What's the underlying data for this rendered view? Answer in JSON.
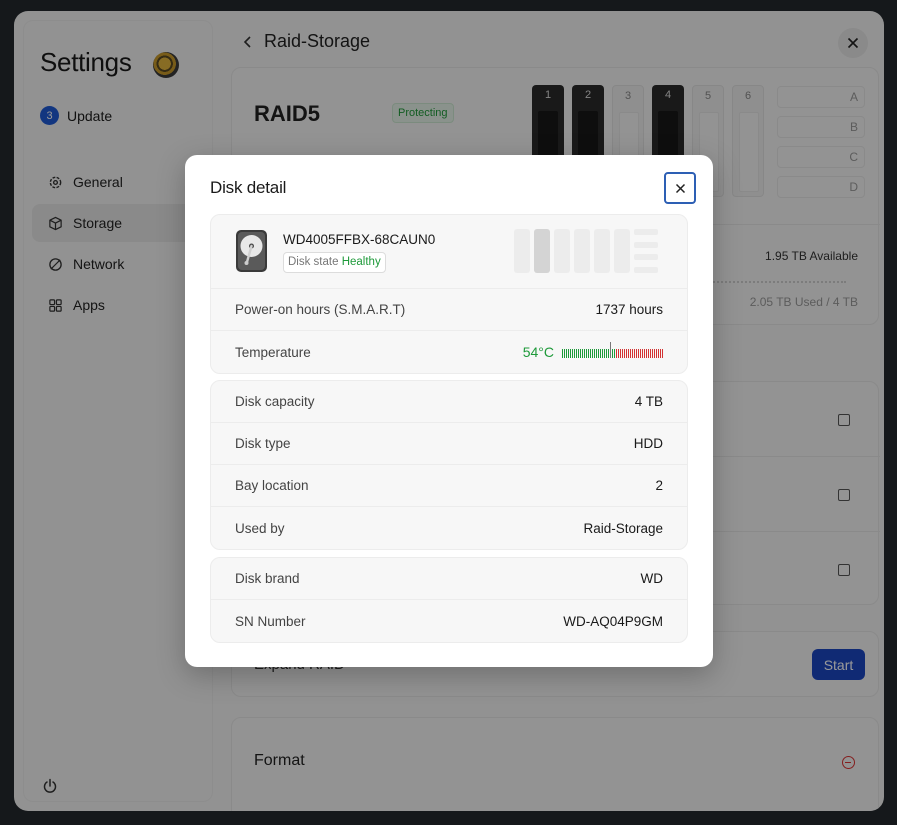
{
  "sidebar": {
    "app_title": "Settings",
    "update_badge": "3",
    "update_label": "Update",
    "items": [
      {
        "label": "General",
        "icon": "gear-icon"
      },
      {
        "label": "Storage",
        "icon": "cube-icon",
        "active": true
      },
      {
        "label": "Network",
        "icon": "globe-icon"
      },
      {
        "label": "Apps",
        "icon": "grid-icon"
      }
    ]
  },
  "main": {
    "title": "Raid-Storage",
    "raid_level": "RAID5",
    "raid_status": "Protecting",
    "bays": [
      {
        "label": "1",
        "occupied": true
      },
      {
        "label": "2",
        "occupied": true
      },
      {
        "label": "3",
        "occupied": false
      },
      {
        "label": "4",
        "occupied": true
      },
      {
        "label": "5",
        "occupied": false
      },
      {
        "label": "6",
        "occupied": false
      }
    ],
    "bay_letters": [
      "A",
      "B",
      "C",
      "D"
    ],
    "available": "1.95 TB Available",
    "used": "2.05 TB Used / 4 TB",
    "expand_label": "Expand RAID",
    "start_button": "Start",
    "format_label": "Format"
  },
  "dialog": {
    "title": "Disk detail",
    "model": "WD4005FFBX-68CAUN0",
    "state_label": "Disk state",
    "state_value": "Healthy",
    "power_on_label": "Power-on hours (S.M.A.R.T)",
    "power_on_value": "1737 hours",
    "temperature_label": "Temperature",
    "temperature_value": "54°C",
    "details": [
      {
        "key": "Disk capacity",
        "value": "4 TB"
      },
      {
        "key": "Disk type",
        "value": "HDD"
      },
      {
        "key": "Bay location",
        "value": "2"
      },
      {
        "key": "Used by",
        "value": "Raid-Storage"
      }
    ],
    "identity": [
      {
        "key": "Disk brand",
        "value": "WD"
      },
      {
        "key": "SN Number",
        "value": "WD-AQ04P9GM"
      }
    ]
  },
  "colors": {
    "healthy": "#1e9a3a",
    "accent": "#1c47c2",
    "danger": "#d33333"
  }
}
